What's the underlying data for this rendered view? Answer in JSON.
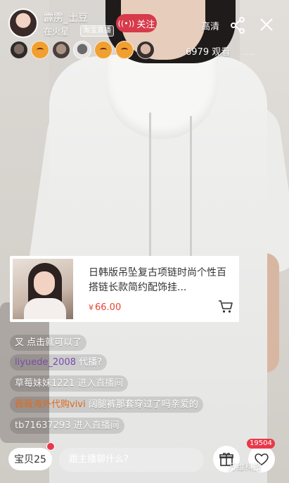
{
  "host": {
    "name": "霹雳_土豆",
    "location": "在火星",
    "platform_tag": "淘宝直播",
    "follow_label": "关注"
  },
  "top_bar": {
    "quality_label": "高清",
    "share_icon": "share-icon",
    "close_icon": "close-icon"
  },
  "viewers": {
    "count_label": "6979 观看",
    "channel_id": "......",
    "avatars": [
      "photo",
      "emoji",
      "photo",
      "photo",
      "emoji",
      "emoji",
      "photo"
    ]
  },
  "product": {
    "title": "日韩版吊坠复古项链时尚个性百搭链长款简约配饰挂...",
    "currency": "¥",
    "price": "66.00",
    "cart_icon": "shopping-cart-icon"
  },
  "chat": [
    {
      "user": "",
      "text": "叉 点击就可以了"
    },
    {
      "user": "liyuede_2008",
      "text": "代播?"
    },
    {
      "user": "草莓妹妹1221",
      "text": "进入直播间",
      "type": "system"
    },
    {
      "user": "薇薇海外代购vivi",
      "text": "阔腿裤那套穿过了吗亲爱的"
    },
    {
      "user": "tb71637293",
      "text": "进入直播间",
      "type": "system"
    }
  ],
  "bottom_bar": {
    "goods_label": "宝贝25",
    "input_placeholder": "跟主播聊什么?",
    "like_count": "19504",
    "watermark": "万维科技"
  },
  "colors": {
    "accent_red": "#d73a4a",
    "price_red": "#e8432e",
    "username_purple": "#7b4bb0",
    "username_orange": "#e06a1e"
  }
}
